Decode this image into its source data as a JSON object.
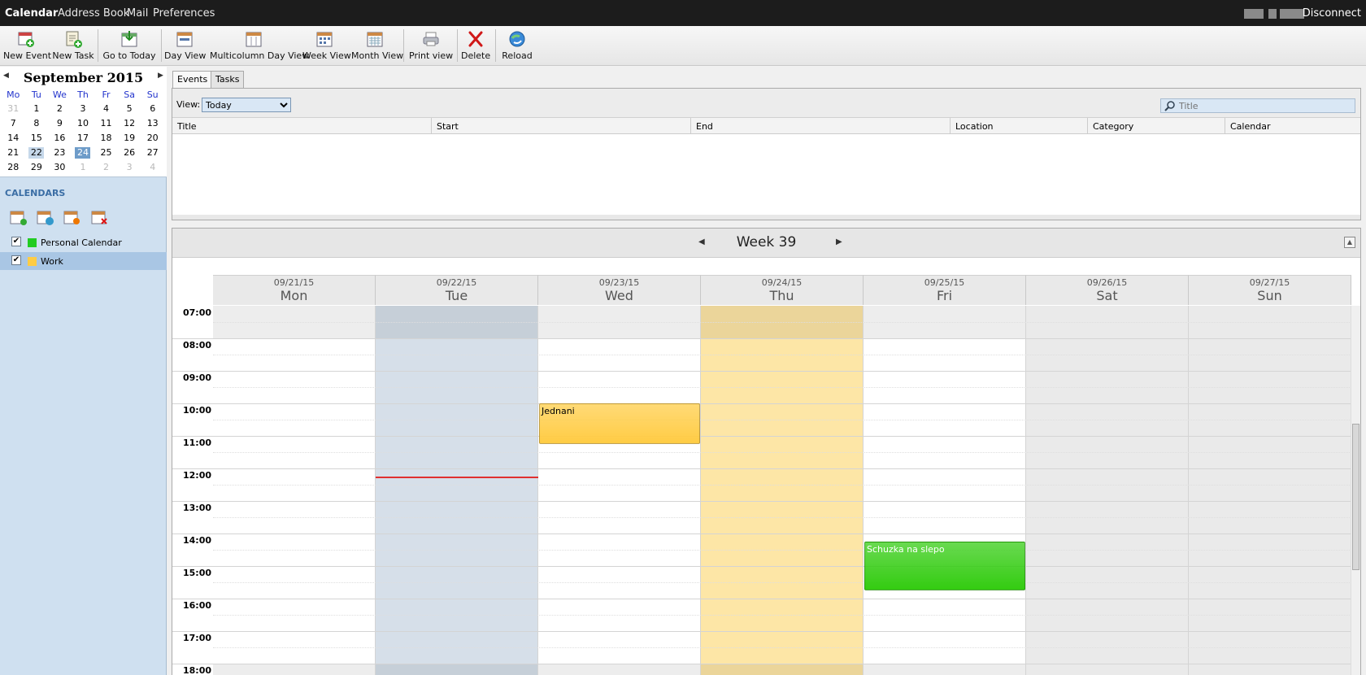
{
  "topnav": {
    "items": [
      "Calendar",
      "Address Book",
      "Mail",
      "Preferences"
    ],
    "disconnect": "Disconnect"
  },
  "toolbar": {
    "new_event": "New Event",
    "new_task": "New Task",
    "go_to_today": "Go to Today",
    "day_view": "Day View",
    "multicolumn_day_view": "Multicolumn Day View",
    "week_view": "Week View",
    "month_view": "Month View",
    "print_view": "Print view",
    "delete": "Delete",
    "reload": "Reload"
  },
  "minical": {
    "month": "September",
    "year": "2015",
    "weekdays": [
      "Mo",
      "Tu",
      "We",
      "Th",
      "Fr",
      "Sa",
      "Su"
    ],
    "weeks": [
      [
        "31",
        "1",
        "2",
        "3",
        "4",
        "5",
        "6"
      ],
      [
        "7",
        "8",
        "9",
        "10",
        "11",
        "12",
        "13"
      ],
      [
        "14",
        "15",
        "16",
        "17",
        "18",
        "19",
        "20"
      ],
      [
        "21",
        "22",
        "23",
        "24",
        "25",
        "26",
        "27"
      ],
      [
        "28",
        "29",
        "30",
        "1",
        "2",
        "3",
        "4"
      ]
    ],
    "today": "22",
    "selected": "24"
  },
  "calendars": {
    "heading": "CALENDARS",
    "items": [
      {
        "label": "Personal Calendar",
        "color": "#22cc22",
        "checked": true
      },
      {
        "label": "Work",
        "color": "#ffcc44",
        "checked": true
      }
    ]
  },
  "tabs": [
    "Events",
    "Tasks"
  ],
  "filter": {
    "view_label": "View:",
    "view_value": "Today",
    "search_placeholder": "Title"
  },
  "list_columns": [
    "Title",
    "Start",
    "End",
    "Location",
    "Category",
    "Calendar"
  ],
  "week": {
    "title": "Week 39",
    "days": [
      {
        "date": "09/21/15",
        "name": "Mon"
      },
      {
        "date": "09/22/15",
        "name": "Tue"
      },
      {
        "date": "09/23/15",
        "name": "Wed"
      },
      {
        "date": "09/24/15",
        "name": "Thu"
      },
      {
        "date": "09/25/15",
        "name": "Fri"
      },
      {
        "date": "09/26/15",
        "name": "Sat"
      },
      {
        "date": "09/27/15",
        "name": "Sun"
      }
    ],
    "hours": [
      "07:00",
      "08:00",
      "09:00",
      "10:00",
      "11:00",
      "12:00",
      "13:00",
      "14:00",
      "15:00",
      "16:00",
      "17:00",
      "18:00"
    ],
    "events": [
      {
        "title": "Jednani",
        "day": "Wed",
        "start": "10:00",
        "end": "11:15",
        "color": "#ffcc44"
      },
      {
        "title": "Schuzka na slepo",
        "day": "Fri",
        "start": "14:15",
        "end": "15:45",
        "color": "#33cc11"
      }
    ],
    "now_time": "12:15",
    "now_day": "Tue"
  },
  "colors": {
    "today_column": "#d6dfe9",
    "selected_column": "#fde6a6",
    "weekend_column": "#eaeaea"
  }
}
